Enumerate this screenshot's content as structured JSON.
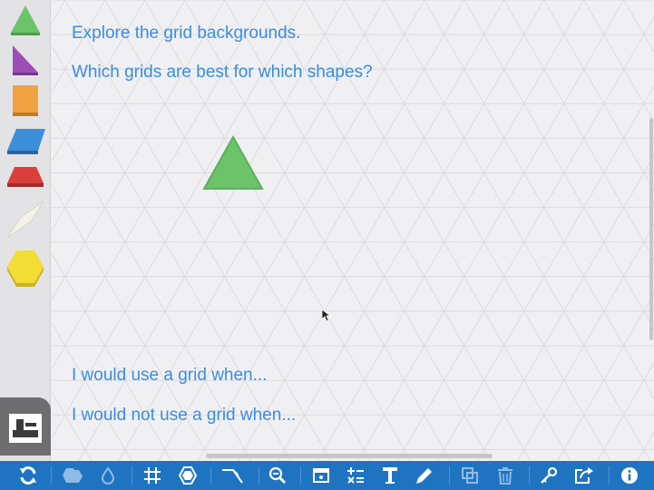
{
  "canvas": {
    "prompt_line1": "Explore the grid backgrounds.",
    "prompt_line2": "Which grids are best for which shapes?",
    "sentence_use": "I would use  a grid when...",
    "sentence_not_use": "I would not use a grid when..."
  },
  "sidebar": {
    "shapes": [
      {
        "name": "triangle",
        "color": "#6cc36a"
      },
      {
        "name": "right-triangle",
        "color": "#9b4fb5"
      },
      {
        "name": "square",
        "color": "#f0a340"
      },
      {
        "name": "parallelogram",
        "color": "#3b8ed8"
      },
      {
        "name": "trapezoid",
        "color": "#d9403c"
      },
      {
        "name": "rhombus",
        "color": "#f4f2e8"
      },
      {
        "name": "hexagon",
        "color": "#f2dd35"
      }
    ],
    "stamp_icon": "stamp-icon"
  },
  "toolbar": {
    "icons": [
      "refresh-icon",
      "shapes-icon",
      "fill-icon",
      "grid-icon",
      "hexagon-grid-icon",
      "angle-icon",
      "zoom-out-icon",
      "hide-icon",
      "math-icon",
      "text-icon",
      "pencil-icon",
      "duplicate-icon",
      "delete-icon",
      "link-icon",
      "share-icon",
      "info-icon"
    ],
    "colors": {
      "background": "#1f74c2",
      "icon": "#ffffff",
      "icon_dim": "#8fbbe4"
    }
  }
}
